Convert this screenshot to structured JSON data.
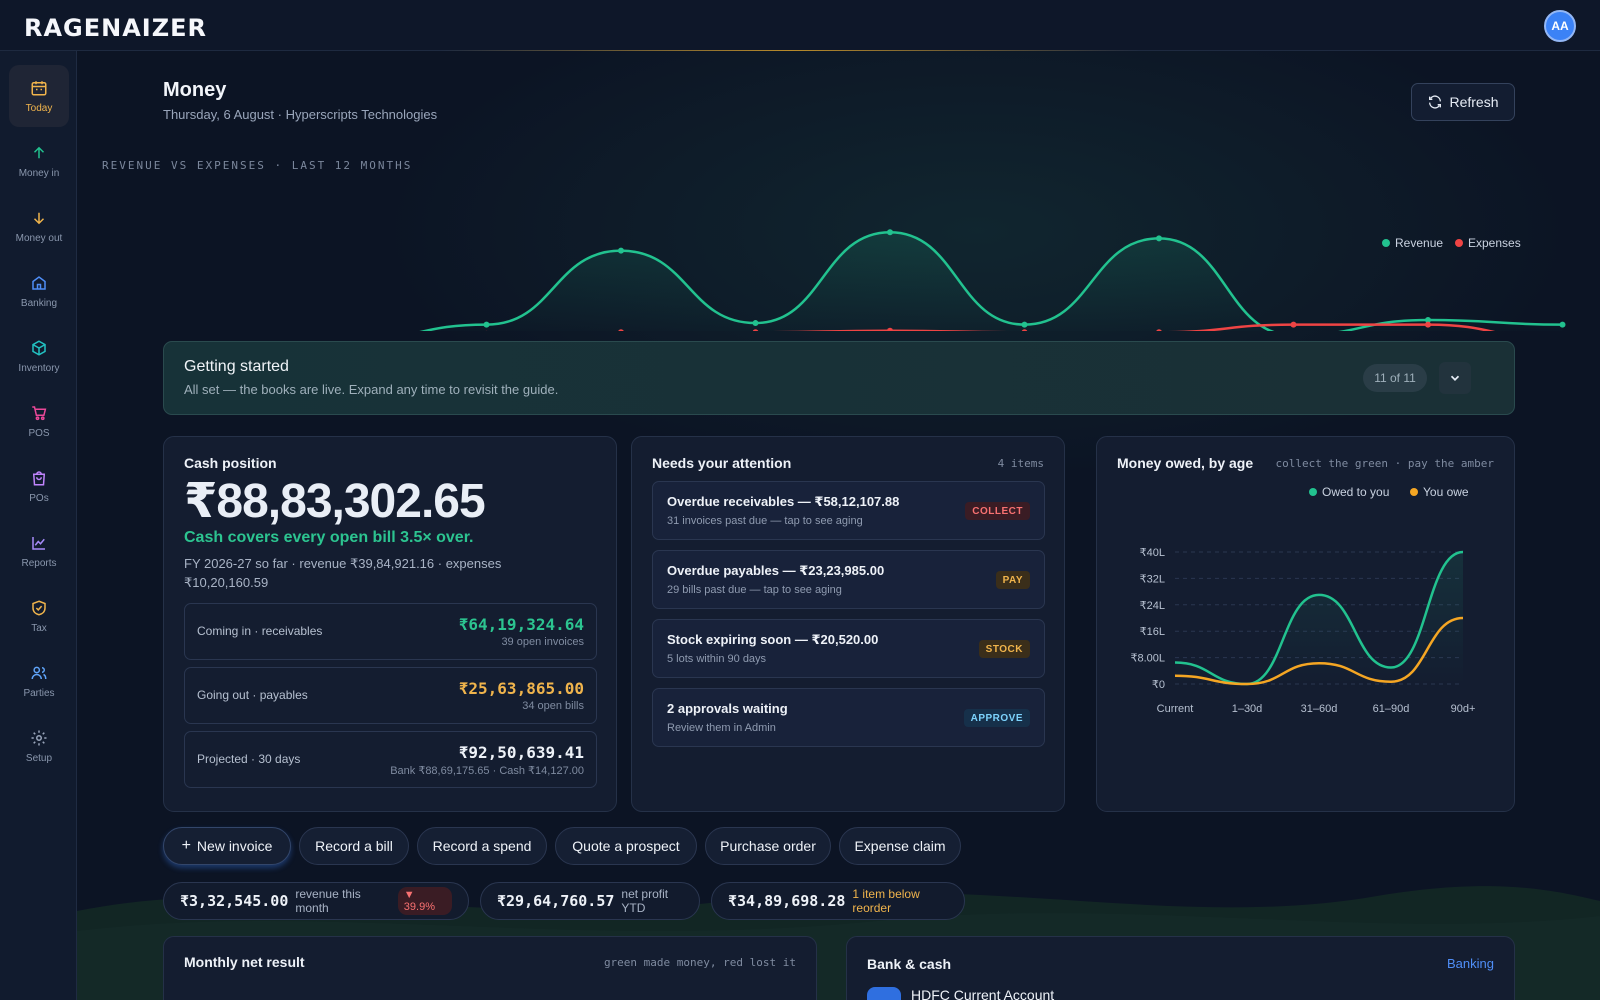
{
  "app": {
    "logo_text": "RAGENAIZER",
    "avatar_initials": "AA"
  },
  "sidebar": {
    "items": [
      {
        "label": "Today",
        "icon": "calendar-icon",
        "active": true
      },
      {
        "label": "Money in",
        "icon": "arrow-up-icon"
      },
      {
        "label": "Money out",
        "icon": "arrow-down-icon"
      },
      {
        "label": "Banking",
        "icon": "bank-icon"
      },
      {
        "label": "Inventory",
        "icon": "box-icon"
      },
      {
        "label": "POS",
        "icon": "cart-icon"
      },
      {
        "label": "POs",
        "icon": "bag-icon"
      },
      {
        "label": "Reports",
        "icon": "chart-icon"
      },
      {
        "label": "Tax",
        "icon": "shield-check-icon"
      },
      {
        "label": "Parties",
        "icon": "users-icon"
      },
      {
        "label": "Setup",
        "icon": "gear-icon"
      }
    ]
  },
  "header": {
    "title": "Money",
    "subtitle": "Thursday, 6 August · Hyperscripts Technologies",
    "refresh_label": "Refresh"
  },
  "revenue_chart": {
    "label": "REVENUE VS EXPENSES · LAST 12 MONTHS",
    "legend": {
      "revenue": "Revenue",
      "expenses": "Expenses"
    },
    "colors": {
      "revenue": "#22c28f",
      "expenses": "#ef4444"
    }
  },
  "getting_started": {
    "title": "Getting started",
    "subtitle": "All set — the books are live. Expand any time to revisit the guide.",
    "progress": "11 of 11"
  },
  "cash_position": {
    "title": "Cash position",
    "amount": "₹88,83,302.65",
    "coverage": "Cash covers every open bill 3.5× over.",
    "fy_summary": "FY 2026-27 so far · revenue ₹39,84,921.16 · expenses ₹10,20,160.59",
    "rows": [
      {
        "label": "Coming in · receivables",
        "amount": "₹64,19,324.64",
        "sub": "39 open invoices",
        "color": "#2cc490"
      },
      {
        "label": "Going out · payables",
        "amount": "₹25,63,865.00",
        "sub": "34 open bills",
        "color": "#f0b44c"
      },
      {
        "label": "Projected · 30 days",
        "amount": "₹92,50,639.41",
        "sub": "Bank ₹88,69,175.65 · Cash ₹14,127.00",
        "color": "#eef2f8"
      }
    ]
  },
  "attention": {
    "title": "Needs your attention",
    "count": "4 items",
    "items": [
      {
        "title": "Overdue receivables — ₹58,12,107.88",
        "sub": "31 invoices past due — tap to see aging",
        "tag": "COLLECT",
        "tag_color": "#f87171",
        "tag_bg": "#3a1c24"
      },
      {
        "title": "Overdue payables — ₹23,23,985.00",
        "sub": "29 bills past due — tap to see aging",
        "tag": "PAY",
        "tag_color": "#f0b44c",
        "tag_bg": "#3a2e1a"
      },
      {
        "title": "Stock expiring soon — ₹20,520.00",
        "sub": "5 lots within 90 days",
        "tag": "STOCK",
        "tag_color": "#f0b44c",
        "tag_bg": "#3a2e1a"
      },
      {
        "title": "2 approvals waiting",
        "sub": "Review them in Admin",
        "tag": "APPROVE",
        "tag_color": "#7dd3fc",
        "tag_bg": "#16304a"
      }
    ]
  },
  "owed": {
    "title": "Money owed, by age",
    "subtitle": "collect the green · pay the amber",
    "legend": {
      "owed_to_you": "Owed to you",
      "you_owe": "You owe"
    },
    "colors": {
      "owed_to_you": "#22c28f",
      "you_owe": "#f5a623"
    },
    "y_ticks": [
      "₹0",
      "₹8.00L",
      "₹16L",
      "₹24L",
      "₹32L",
      "₹40L"
    ],
    "x_ticks": [
      "Current",
      "1–30d",
      "31–60d",
      "61–90d",
      "90d+"
    ]
  },
  "chart_data": [
    {
      "type": "line",
      "title": "REVENUE VS EXPENSES · LAST 12 MONTHS",
      "x": [
        1,
        2,
        3,
        4,
        5,
        6,
        7,
        8,
        9,
        10,
        11,
        12
      ],
      "series": [
        {
          "name": "Revenue",
          "values": [
            0,
            0,
            0,
            1.0,
            5.8,
            1.1,
            7.0,
            1.0,
            6.6,
            0.3,
            1.3,
            1.0
          ]
        },
        {
          "name": "Expenses",
          "values": [
            0,
            0,
            0,
            0.4,
            0.5,
            0.5,
            0.6,
            0.5,
            0.5,
            1.0,
            1.0,
            0
          ]
        }
      ],
      "grid": false,
      "legend": "right"
    },
    {
      "type": "line",
      "title": "Money owed, by age",
      "categories": [
        "Current",
        "1–30d",
        "31–60d",
        "61–90d",
        "90d+"
      ],
      "series": [
        {
          "name": "Owed to you",
          "values": [
            6.5,
            0,
            27,
            5,
            40
          ]
        },
        {
          "name": "You owe",
          "values": [
            2.5,
            0,
            6.3,
            0.7,
            20
          ]
        }
      ],
      "ylim": [
        0,
        40
      ],
      "yunit": "L",
      "grid": true,
      "legend": "top-right"
    }
  ],
  "quick_actions": [
    "New invoice",
    "Record a bill",
    "Record a spend",
    "Quote a prospect",
    "Purchase order",
    "Expense claim"
  ],
  "kpis": [
    {
      "value": "₹3,32,545.00",
      "label": "revenue this month",
      "delta": "▼ 39.9%"
    },
    {
      "value": "₹29,64,760.57",
      "label": "net profit YTD"
    },
    {
      "value": "₹34,89,698.28",
      "label": "1 item below reorder",
      "label_color": "#f0b44c"
    }
  ],
  "monthly_net": {
    "title": "Monthly net result",
    "subtitle": "green made money, red lost it"
  },
  "bank_cash": {
    "title": "Bank & cash",
    "link": "Banking",
    "account": "HDFC Current Account"
  }
}
